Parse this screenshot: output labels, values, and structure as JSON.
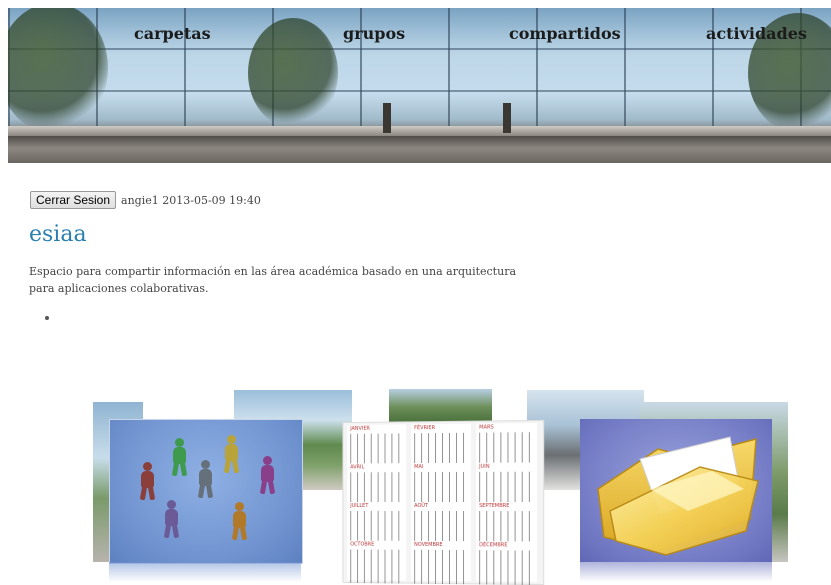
{
  "nav": {
    "items": [
      {
        "label": "carpetas"
      },
      {
        "label": "grupos"
      },
      {
        "label": "compartidos"
      },
      {
        "label": "actividades"
      }
    ]
  },
  "session": {
    "logout_label": "Cerrar Sesion",
    "info": "angie1 2013-05-09 19:40"
  },
  "site": {
    "title": "esiaa",
    "description": "Espacio para compartir información en las área académica basado en una arquitectura para aplicaciones colaborativas."
  },
  "calendar": {
    "months": [
      "JANVIER",
      "FÉVRIER",
      "MARS",
      "AVRIL",
      "MAI",
      "JUIN",
      "JUILLET",
      "AOÛT",
      "SEPTEMBRE",
      "OCTOBRE",
      "NOVEMBRE",
      "DÉCEMBRE"
    ]
  },
  "colors": {
    "title": "#2a7fb0",
    "text": "#444444",
    "nav_text": "#1b1b1b"
  }
}
